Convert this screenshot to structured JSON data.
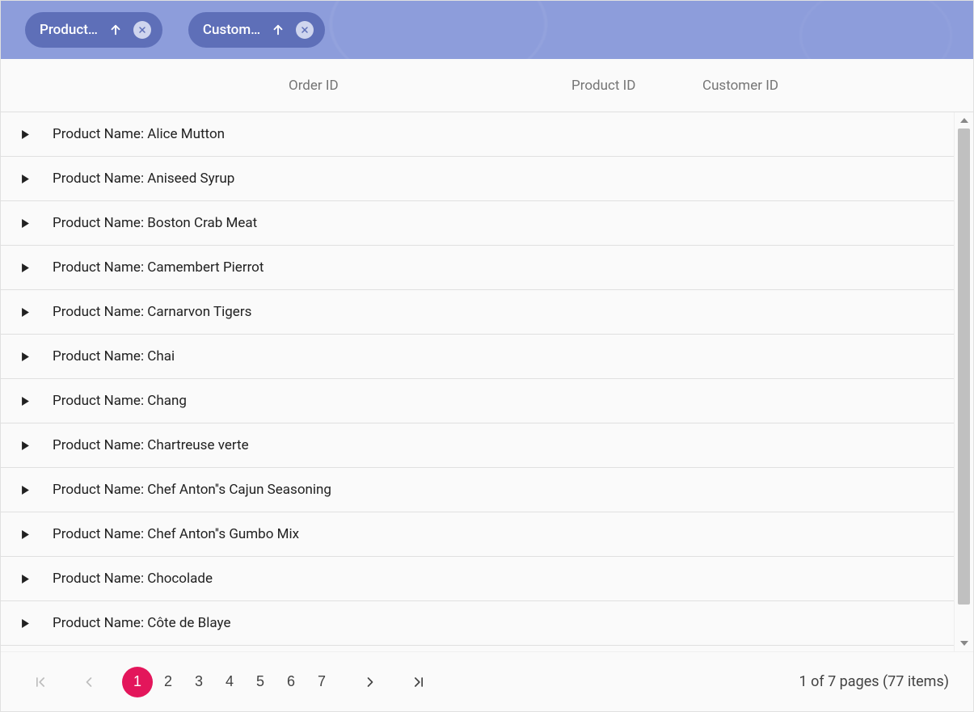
{
  "group_chips": [
    {
      "label": "Product…",
      "sort_dir": "asc"
    },
    {
      "label": "Custom…",
      "sort_dir": "asc"
    }
  ],
  "columns": {
    "order_id": "Order ID",
    "product_id": "Product ID",
    "customer_id": "Customer ID"
  },
  "group_label_prefix": "Product Name: ",
  "groups": [
    "Alice Mutton",
    "Aniseed Syrup",
    "Boston Crab Meat",
    "Camembert Pierrot",
    "Carnarvon Tigers",
    "Chai",
    "Chang",
    "Chartreuse verte",
    "Chef Anton''s Cajun Seasoning",
    "Chef Anton''s Gumbo Mix",
    "Chocolade",
    "Côte de Blaye"
  ],
  "pager": {
    "pages": [
      "1",
      "2",
      "3",
      "4",
      "5",
      "6",
      "7"
    ],
    "current_page": "1",
    "message": "1 of 7 pages (77 items)"
  }
}
